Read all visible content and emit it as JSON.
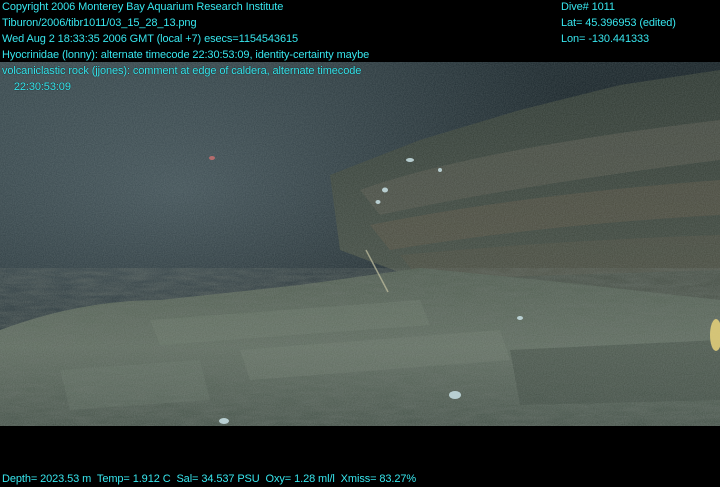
{
  "overlay": {
    "left_lines": [
      "Copyright 2006 Monterey Bay Aquarium Research Institute",
      "Tiburon/2006/tibr1011/03_15_28_13.png",
      "Wed Aug  2 18:33:35 2006 GMT (local +7)  esecs=1154543615",
      "Hyocrinidae (lonny): alternate timecode 22:30:53:09, identity-certainty maybe",
      "volcaniclastic rock (jjones): comment at edge of caldera, alternate timecode",
      "    22:30:53:09"
    ],
    "right_lines": [
      "Dive# 1011",
      "Lat= 45.396953 (edited)",
      "Lon= -130.441333"
    ],
    "bottom_line": "Depth= 2023.53 m  Temp= 1.912 C  Sal= 34.537 PSU  Oxy= 1.28 ml/l  Xmiss= 83.27%"
  },
  "scene": {
    "description_icon": "underwater-rock-scene",
    "colors": {
      "water_dark": "#0b1418",
      "water_mid": "#1f3036",
      "rock_light": "#5d6b5e",
      "rock_mid": "#3e4a40",
      "overlay_text": "#37e6ee"
    }
  }
}
